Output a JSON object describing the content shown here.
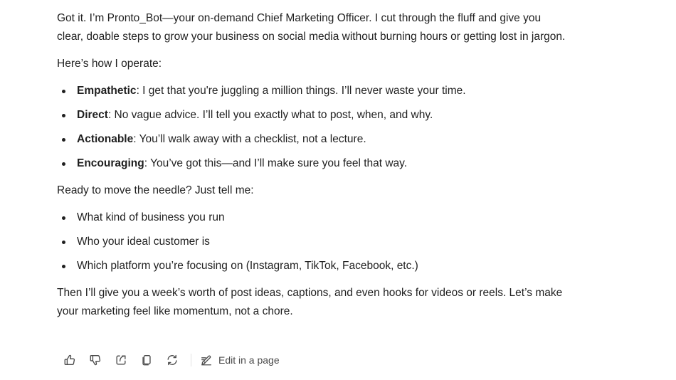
{
  "message": {
    "intro": "Got it. I’m Pronto_Bot—your on-demand Chief Marketing Officer. I cut through the fluff and give you clear, doable steps to grow your business on social media without burning hours or getting lost in jargon.",
    "operate_heading": "Here’s how I operate:",
    "traits": [
      {
        "term": "Empathetic",
        "desc": ": I get that you're juggling a million things. I’ll never waste your time."
      },
      {
        "term": "Direct",
        "desc": ": No vague advice. I’ll tell you exactly what to post, when, and why."
      },
      {
        "term": "Actionable",
        "desc": ": You’ll walk away with a checklist, not a lecture."
      },
      {
        "term": "Encouraging",
        "desc": ": You’ve got this—and I’ll make sure you feel that way."
      }
    ],
    "ready_heading": "Ready to move the needle? Just tell me:",
    "questions": [
      "What kind of business you run",
      "Who your ideal customer is",
      "Which platform you’re focusing on (Instagram, TikTok, Facebook, etc.)"
    ],
    "closing": "Then I’ll give you a week’s worth of post ideas, captions, and even hooks for videos or reels. Let’s make your marketing feel like momentum, not a chore."
  },
  "toolbar": {
    "icons": [
      "thumbs-up-icon",
      "thumbs-down-icon",
      "share-icon",
      "copy-icon",
      "regenerate-icon",
      "edit-page-icon"
    ],
    "edit_label": "Edit in a page"
  }
}
